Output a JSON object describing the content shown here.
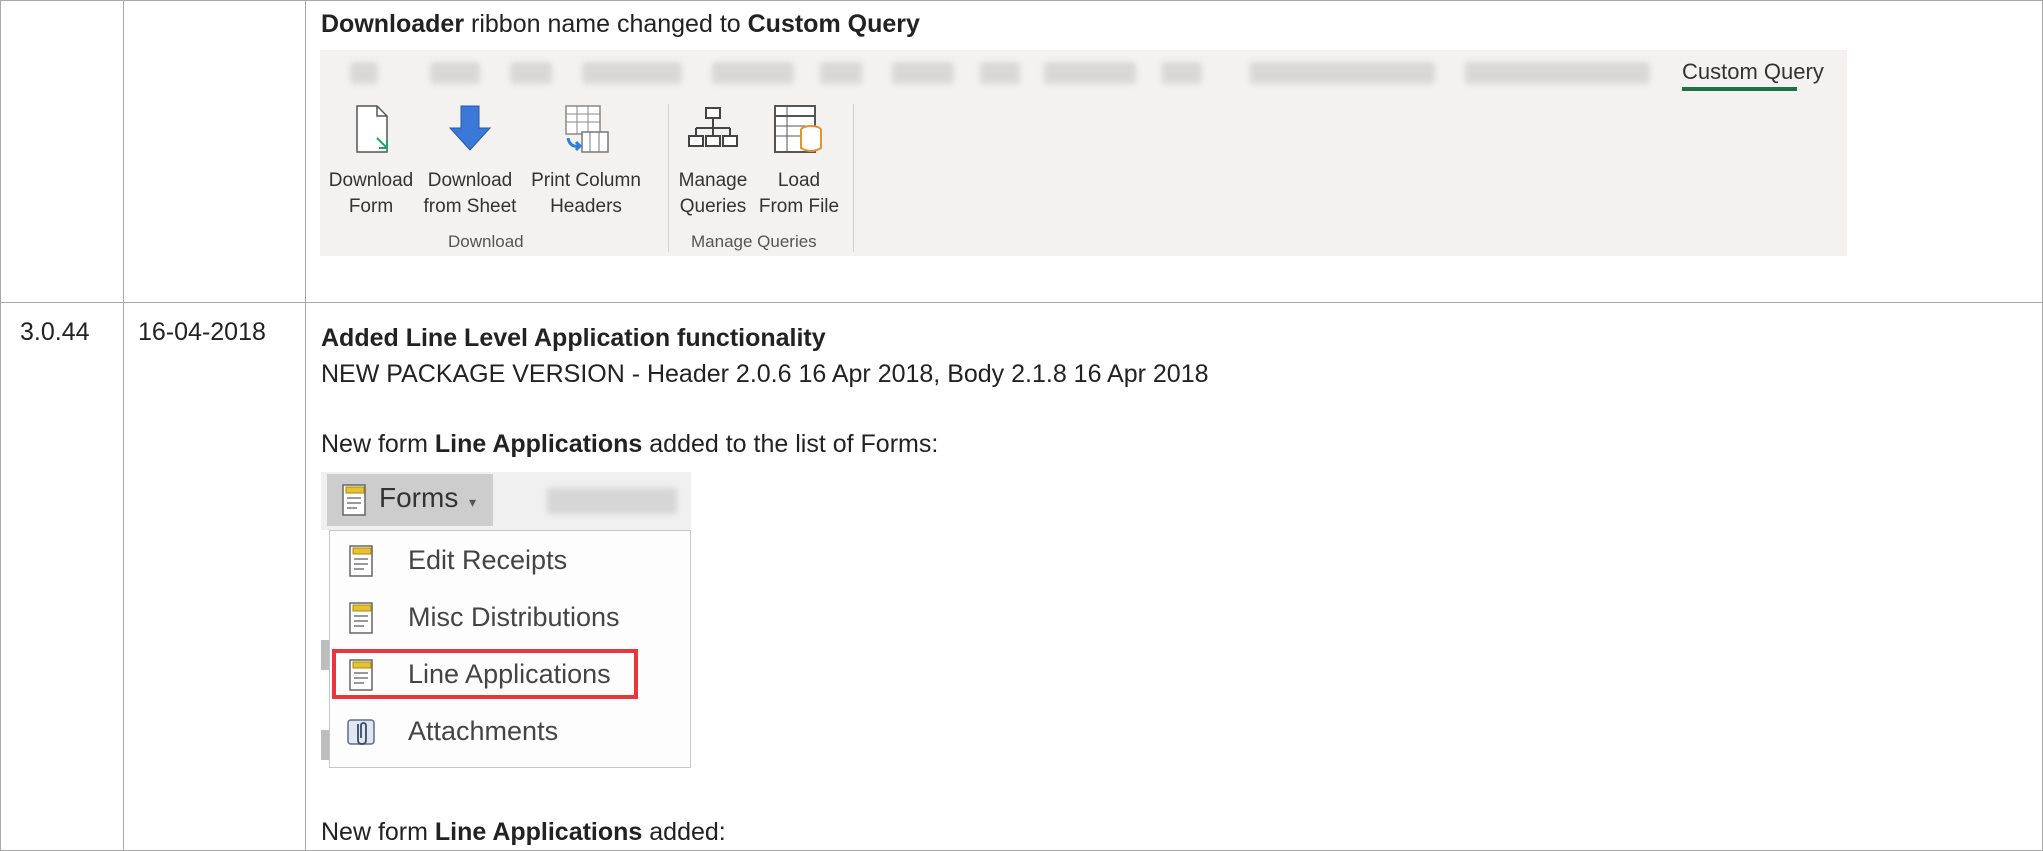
{
  "row1": {
    "heading_bold1": "Downloader",
    "heading_mid": " ribbon name changed to ",
    "heading_bold2": "Custom Query",
    "ribbon": {
      "active_tab": "Custom Query",
      "active_tab_color": "#1e7145",
      "groups": [
        {
          "label": "Download",
          "buttons": [
            {
              "label_l1": "Download",
              "label_l2": "Form",
              "icon": "document-arrow-icon"
            },
            {
              "label_l1": "Download",
              "label_l2": "from Sheet",
              "icon": "down-arrow-icon"
            },
            {
              "label_l1": "Print Column",
              "label_l2": "Headers",
              "icon": "table-headers-icon"
            }
          ]
        },
        {
          "label": "Manage Queries",
          "buttons": [
            {
              "label_l1": "Manage",
              "label_l2": "Queries",
              "icon": "hierarchy-icon"
            },
            {
              "label_l1": "Load",
              "label_l2": "From File",
              "icon": "table-database-icon"
            }
          ]
        }
      ]
    }
  },
  "row2": {
    "version": "3.0.44",
    "date": "16-04-2018",
    "title": "Added Line Level Application functionality",
    "package_line": "NEW PACKAGE VERSION - Header 2.0.6 16 Apr 2018, Body 2.1.8 16 Apr 2018",
    "intro_pre": "New form ",
    "intro_bold": "Line Applications",
    "intro_post": " added to the list of Forms:",
    "forms_menu": {
      "button_label": "Forms",
      "items": [
        {
          "label": "Edit Receipts",
          "icon": "form-icon"
        },
        {
          "label": "Misc Distributions",
          "icon": "form-icon"
        },
        {
          "label": "Line Applications",
          "icon": "form-icon",
          "highlighted": true
        },
        {
          "label": "Attachments",
          "icon": "attachment-icon"
        }
      ],
      "highlight_color": "#e8363a"
    },
    "footer_pre": "New form ",
    "footer_bold": "Line Applications",
    "footer_post": " added:"
  }
}
